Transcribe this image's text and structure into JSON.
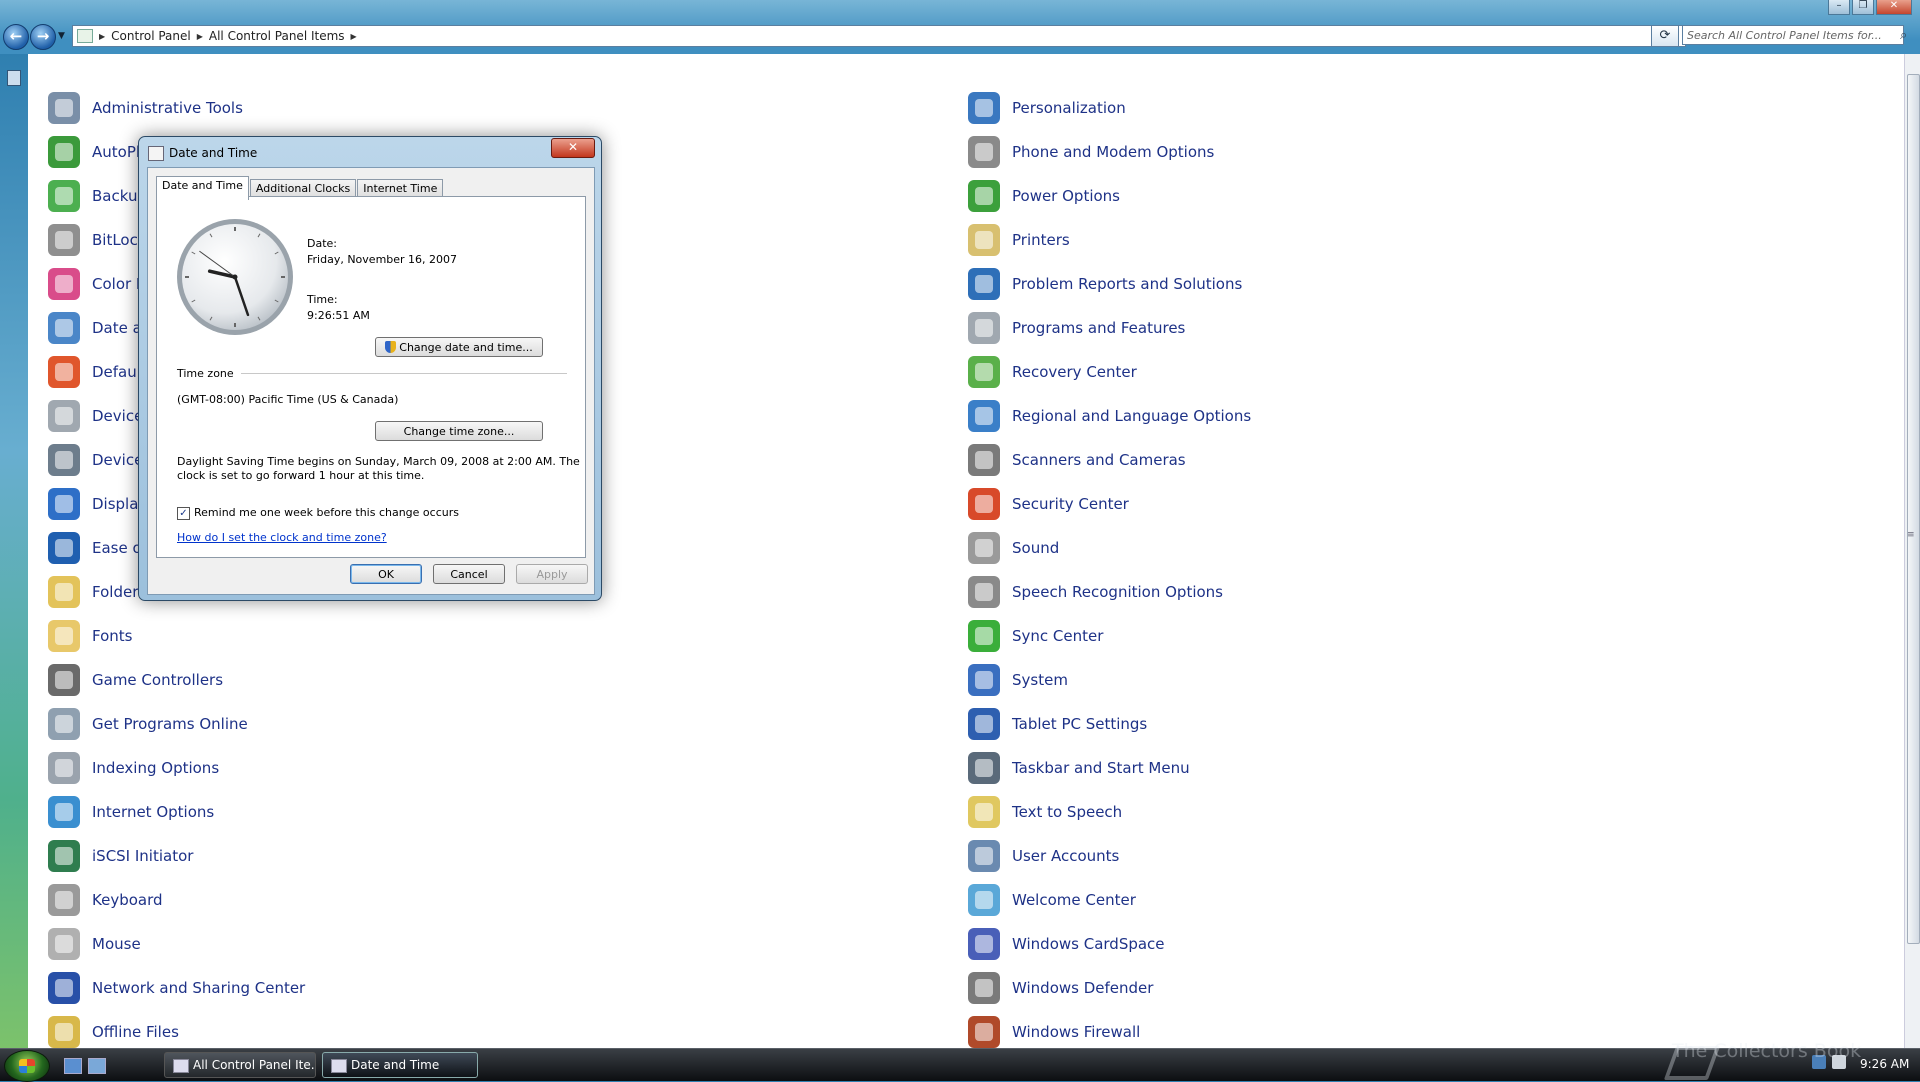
{
  "address": {
    "crumbs": [
      "Control Panel",
      "All Control Panel Items"
    ],
    "search_placeholder": "Search All Control Panel Items for..."
  },
  "items_left": [
    {
      "label": "Administrative Tools",
      "color": "#7a8fa8"
    },
    {
      "label": "AutoPlay",
      "color": "#3b9a3b"
    },
    {
      "label": "Backup and Restore Center",
      "color": "#4caf50"
    },
    {
      "label": "BitLocker Drive Encryption",
      "color": "#8f8f8f"
    },
    {
      "label": "Color Management",
      "color": "#d94c8a"
    },
    {
      "label": "Date and Time",
      "color": "#4a86c8"
    },
    {
      "label": "Default Programs",
      "color": "#e0562c"
    },
    {
      "label": "Device Manager",
      "color": "#a0a8b0"
    },
    {
      "label": "Device Manager",
      "color": "#6d7d8c"
    },
    {
      "label": "Display",
      "color": "#2e6fc7"
    },
    {
      "label": "Ease of Access Center",
      "color": "#1f5fb0"
    },
    {
      "label": "Folder Options",
      "color": "#e3c35a"
    },
    {
      "label": "Fonts",
      "color": "#e8c86a"
    },
    {
      "label": "Game Controllers",
      "color": "#6a6a6a"
    },
    {
      "label": "Get Programs Online",
      "color": "#8fa0b0"
    },
    {
      "label": "Indexing Options",
      "color": "#9aa3ad"
    },
    {
      "label": "Internet Options",
      "color": "#3a8fd0"
    },
    {
      "label": "iSCSI Initiator",
      "color": "#2f7d4f"
    },
    {
      "label": "Keyboard",
      "color": "#9a9a9a"
    },
    {
      "label": "Mouse",
      "color": "#b0b0b0"
    },
    {
      "label": "Network and Sharing Center",
      "color": "#2850a8"
    },
    {
      "label": "Offline Files",
      "color": "#d8b84a"
    }
  ],
  "items_right": [
    {
      "label": "Personalization",
      "color": "#3a78c0"
    },
    {
      "label": "Phone and Modem Options",
      "color": "#8a8a8a"
    },
    {
      "label": "Power Options",
      "color": "#3ca03c"
    },
    {
      "label": "Printers",
      "color": "#d8c070"
    },
    {
      "label": "Problem Reports and Solutions",
      "color": "#2e6fb8"
    },
    {
      "label": "Programs and Features",
      "color": "#a0a8b0"
    },
    {
      "label": "Recovery Center",
      "color": "#5ab04a"
    },
    {
      "label": "Regional and Language Options",
      "color": "#3a7fc8"
    },
    {
      "label": "Scanners and Cameras",
      "color": "#7a7a7a"
    },
    {
      "label": "Security Center",
      "color": "#d84a2a"
    },
    {
      "label": "Sound",
      "color": "#9a9a9a"
    },
    {
      "label": "Speech Recognition Options",
      "color": "#8a8a8a"
    },
    {
      "label": "Sync Center",
      "color": "#3aae3a"
    },
    {
      "label": "System",
      "color": "#3a6fc0"
    },
    {
      "label": "Tablet PC Settings",
      "color": "#2e5fb0"
    },
    {
      "label": "Taskbar and Start Menu",
      "color": "#5a6a7a"
    },
    {
      "label": "Text to Speech",
      "color": "#e0c860"
    },
    {
      "label": "User Accounts",
      "color": "#6a8ab0"
    },
    {
      "label": "Welcome Center",
      "color": "#5aa8d8"
    },
    {
      "label": "Windows CardSpace",
      "color": "#4a5fb8"
    },
    {
      "label": "Windows Defender",
      "color": "#7a7a7a"
    },
    {
      "label": "Windows Firewall",
      "color": "#b04a2a"
    }
  ],
  "dialog": {
    "title": "Date and Time",
    "close_glyph": "✕",
    "tabs": [
      "Date and Time",
      "Additional Clocks",
      "Internet Time"
    ],
    "date_label": "Date:",
    "date_value": "Friday, November 16, 2007",
    "time_label": "Time:",
    "time_value": "9:26:51 AM",
    "change_datetime_button": "Change date and time...",
    "timezone_heading": "Time zone",
    "timezone_value": "(GMT-08:00) Pacific Time (US & Canada)",
    "change_timezone_button": "Change time zone...",
    "dst_line1": "Daylight Saving Time begins on Sunday, March 09, 2008 at 2:00 AM. The",
    "dst_line2": "clock is set to go forward 1 hour at this time.",
    "remind_checkbox_label": "Remind me one week before this change occurs",
    "remind_checked": true,
    "help_link": "How do I set the clock and time zone?",
    "ok_button": "OK",
    "cancel_button": "Cancel",
    "apply_button": "Apply",
    "clock": {
      "hour": 9,
      "minute": 26,
      "second": 51
    }
  },
  "taskbar": {
    "tasks": [
      "All Control Panel Ite...",
      "Date and Time"
    ],
    "clock": "9:26 AM"
  },
  "watermark": "The Collectors Book"
}
